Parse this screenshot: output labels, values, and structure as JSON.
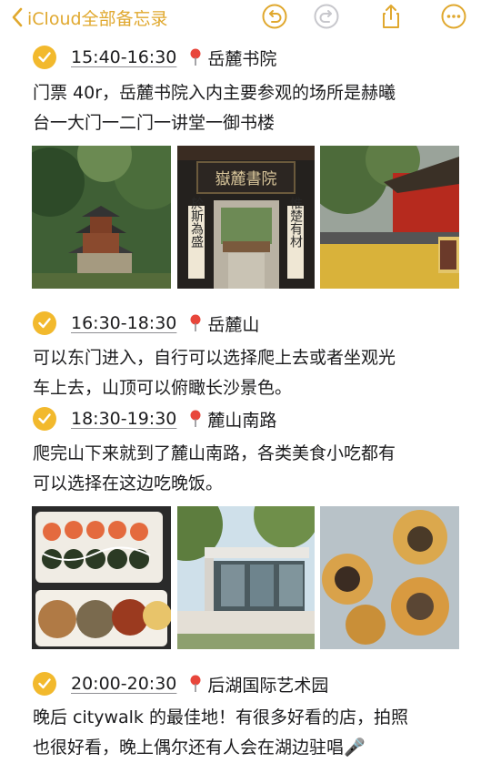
{
  "nav": {
    "back_label": "iCloud全部备忘录"
  },
  "colors": {
    "accent": "#e0a82e",
    "check": "#f2b92d",
    "pin": "#e8463b"
  },
  "icons": [
    "chevron-left-icon",
    "undo-icon",
    "redo-icon",
    "share-icon",
    "more-icon",
    "checkmark-icon",
    "location-pin-icon"
  ],
  "entries": [
    {
      "time": "15:40-16:30",
      "place": "岳麓书院",
      "text_lines": [
        "门票 40r，岳麓书院入内主要参观的场所是赫曦",
        "台一大门一二门一讲堂一御书楼"
      ]
    },
    {
      "time": "16:30-18:30",
      "place": "岳麓山",
      "text_lines": [
        "可以东门进入，自行可以选择爬上去或者坐观光",
        "车上去，山顶可以俯瞰长沙景色。"
      ]
    },
    {
      "time": "18:30-19:30",
      "place": "麓山南路",
      "text_lines": [
        "爬完山下来就到了麓山南路，各类美食小吃都有",
        "可以选择在这边吃晚饭。"
      ]
    },
    {
      "time": "20:00-20:30",
      "place": "后湖国际艺术园",
      "text_lines": [
        "晚后 citywalk 的最佳地！有很多好看的店，拍照",
        "也很好看，晚上偶尔还有人会在湖边驻唱🎤"
      ]
    }
  ],
  "signs": {
    "plaque": "嶽麓書院",
    "couplet_left": "於斯為盛",
    "couplet_right": "惟楚有材"
  }
}
